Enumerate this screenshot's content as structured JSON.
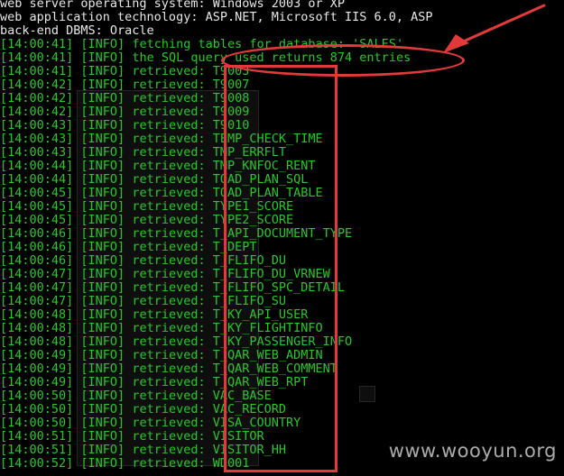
{
  "terminal": {
    "header": [
      "web server operating system: Windows 2003 or XP",
      "web application technology: ASP.NET, Microsoft IIS 6.0, ASP",
      "back-end DBMS: Oracle"
    ],
    "log": [
      {
        "time": "[14:00:41]",
        "level": "[INFO]",
        "msg": "fetching tables for database: 'SALES'"
      },
      {
        "time": "[14:00:41]",
        "level": "[INFO]",
        "msg": "the SQL query used returns 874 entries"
      },
      {
        "time": "[14:00:41]",
        "level": "[INFO]",
        "msg": "retrieved: T9003"
      },
      {
        "time": "[14:00:42]",
        "level": "[INFO]",
        "msg": "retrieved: T9007"
      },
      {
        "time": "[14:00:42]",
        "level": "[INFO]",
        "msg": "retrieved: T9008"
      },
      {
        "time": "[14:00:42]",
        "level": "[INFO]",
        "msg": "retrieved: T9009"
      },
      {
        "time": "[14:00:43]",
        "level": "[INFO]",
        "msg": "retrieved: T9010"
      },
      {
        "time": "[14:00:43]",
        "level": "[INFO]",
        "msg": "retrieved: TEMP_CHECK_TIME"
      },
      {
        "time": "[14:00:43]",
        "level": "[INFO]",
        "msg": "retrieved: TMP_ERRFLT"
      },
      {
        "time": "[14:00:44]",
        "level": "[INFO]",
        "msg": "retrieved: TMP_KNFOC_RENT"
      },
      {
        "time": "[14:00:44]",
        "level": "[INFO]",
        "msg": "retrieved: TOAD_PLAN_SQL"
      },
      {
        "time": "[14:00:45]",
        "level": "[INFO]",
        "msg": "retrieved: TOAD_PLAN_TABLE"
      },
      {
        "time": "[14:00:45]",
        "level": "[INFO]",
        "msg": "retrieved: TYPE1_SCORE"
      },
      {
        "time": "[14:00:45]",
        "level": "[INFO]",
        "msg": "retrieved: TYPE2_SCORE"
      },
      {
        "time": "[14:00:46]",
        "level": "[INFO]",
        "msg": "retrieved: T_API_DOCUMENT_TYPE"
      },
      {
        "time": "[14:00:46]",
        "level": "[INFO]",
        "msg": "retrieved: T_DEPT"
      },
      {
        "time": "[14:00:46]",
        "level": "[INFO]",
        "msg": "retrieved: T_FLIFO_DU"
      },
      {
        "time": "[14:00:47]",
        "level": "[INFO]",
        "msg": "retrieved: T_FLIFO_DU_VRNEW"
      },
      {
        "time": "[14:00:47]",
        "level": "[INFO]",
        "msg": "retrieved: T_FLIFO_SPC_DETAIL"
      },
      {
        "time": "[14:00:47]",
        "level": "[INFO]",
        "msg": "retrieved: T_FLIFO_SU"
      },
      {
        "time": "[14:00:48]",
        "level": "[INFO]",
        "msg": "retrieved: T_KY_API_USER"
      },
      {
        "time": "[14:00:48]",
        "level": "[INFO]",
        "msg": "retrieved: T_KY_FLIGHTINFO"
      },
      {
        "time": "[14:00:48]",
        "level": "[INFO]",
        "msg": "retrieved: T_KY_PASSENGER_INFO"
      },
      {
        "time": "[14:00:49]",
        "level": "[INFO]",
        "msg": "retrieved: T_QAR_WEB_ADMIN"
      },
      {
        "time": "[14:00:49]",
        "level": "[INFO]",
        "msg": "retrieved: T_QAR_WEB_COMMENT"
      },
      {
        "time": "[14:00:49]",
        "level": "[INFO]",
        "msg": "retrieved: T_QAR_WEB_RPT"
      },
      {
        "time": "[14:00:50]",
        "level": "[INFO]",
        "msg": "retrieved: VAC_BASE"
      },
      {
        "time": "[14:00:50]",
        "level": "[INFO]",
        "msg": "retrieved: VAC_RECORD"
      },
      {
        "time": "[14:00:50]",
        "level": "[INFO]",
        "msg": "retrieved: VISA_COUNTRY"
      },
      {
        "time": "[14:00:51]",
        "level": "[INFO]",
        "msg": "retrieved: VISITOR"
      },
      {
        "time": "[14:00:51]",
        "level": "[INFO]",
        "msg": "retrieved: VISITOR_HH"
      },
      {
        "time": "[14:00:52]",
        "level": "[INFO]",
        "msg": "retrieved: WD001"
      }
    ]
  },
  "watermark": "www.wooyun.org",
  "colors": {
    "background": "#000000",
    "header_text": "#e8e8e8",
    "log_text": "#28c828",
    "annotation": "#e23a3a"
  }
}
